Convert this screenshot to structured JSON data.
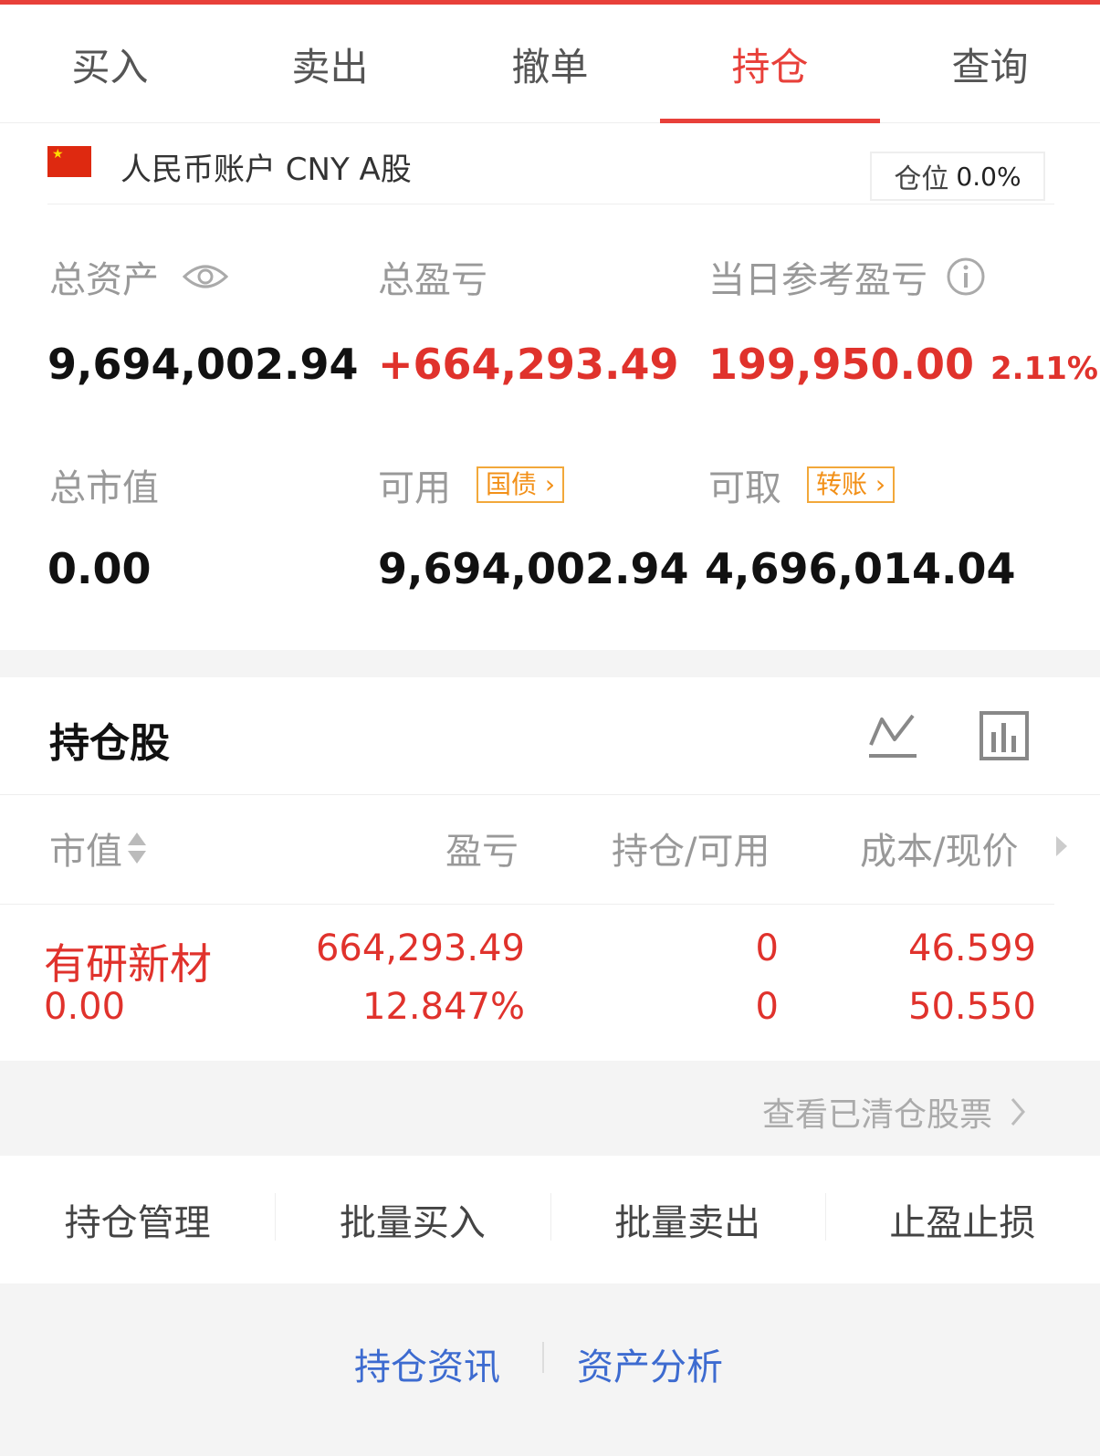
{
  "tabs": [
    {
      "label": "买入"
    },
    {
      "label": "卖出"
    },
    {
      "label": "撤单"
    },
    {
      "label": "持仓"
    },
    {
      "label": "查询"
    }
  ],
  "active_tab": "持仓",
  "account": {
    "name": "人民币账户 CNY A股",
    "position_label": "仓位",
    "position_value": "0.0%"
  },
  "summary": {
    "total_assets_label": "总资产",
    "total_assets": "9,694,002.94",
    "total_pl_label": "总盈亏",
    "total_pl": "+664,293.49",
    "daily_pl_label": "当日参考盈亏",
    "daily_pl": "199,950.00",
    "daily_pl_pct": "2.11%",
    "market_value_label": "总市值",
    "market_value": "0.00",
    "available_label": "可用",
    "available_tag": "国债",
    "available": "9,694,002.94",
    "withdrawable_label": "可取",
    "withdrawable_tag": "转账",
    "withdrawable": "4,696,014.04"
  },
  "holdings": {
    "title": "持仓股",
    "columns": [
      "市值",
      "盈亏",
      "持仓/可用",
      "成本/现价"
    ],
    "rows": [
      {
        "name": "有研新材",
        "market_value": "0.00",
        "pl": "664,293.49",
        "pl_pct": "12.847%",
        "position": "0",
        "available": "0",
        "cost": "46.599",
        "price": "50.550"
      }
    ],
    "cleared_link": "查看已清仓股票"
  },
  "actions": [
    "持仓管理",
    "批量买入",
    "批量卖出",
    "止盈止损"
  ],
  "links": [
    "持仓资讯",
    "资产分析"
  ],
  "colors": {
    "accent": "#e8403a",
    "tag": "#f29018",
    "link": "#3d6bd0"
  }
}
